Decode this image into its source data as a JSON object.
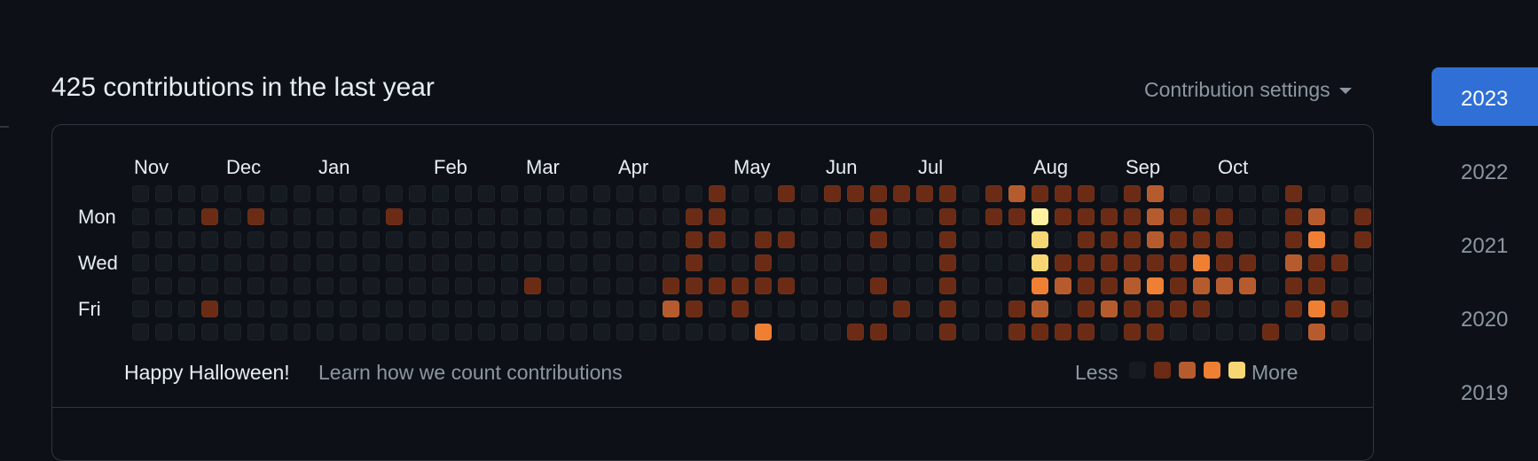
{
  "header": {
    "title": "425 contributions in the last year",
    "settings_label": "Contribution settings"
  },
  "calendar": {
    "months": [
      "Nov",
      "Dec",
      "Jan",
      "Feb",
      "Mar",
      "Apr",
      "May",
      "Jun",
      "Jul",
      "Aug",
      "Sep",
      "Oct"
    ],
    "day_labels": [
      "Mon",
      "Wed",
      "Fri"
    ],
    "weeks": [
      [
        0,
        0,
        0,
        0,
        0,
        0,
        0
      ],
      [
        0,
        0,
        0,
        0,
        0,
        0,
        0
      ],
      [
        0,
        0,
        0,
        0,
        0,
        0,
        0
      ],
      [
        0,
        1,
        0,
        0,
        0,
        1,
        0
      ],
      [
        0,
        0,
        0,
        0,
        0,
        0,
        0
      ],
      [
        0,
        1,
        0,
        0,
        0,
        0,
        0
      ],
      [
        0,
        0,
        0,
        0,
        0,
        0,
        0
      ],
      [
        0,
        0,
        0,
        0,
        0,
        0,
        0
      ],
      [
        0,
        0,
        0,
        0,
        0,
        0,
        0
      ],
      [
        0,
        0,
        0,
        0,
        0,
        0,
        0
      ],
      [
        0,
        0,
        0,
        0,
        0,
        0,
        0
      ],
      [
        0,
        1,
        0,
        0,
        0,
        0,
        0
      ],
      [
        0,
        0,
        0,
        0,
        0,
        0,
        0
      ],
      [
        0,
        0,
        0,
        0,
        0,
        0,
        0
      ],
      [
        0,
        0,
        0,
        0,
        0,
        0,
        0
      ],
      [
        0,
        0,
        0,
        0,
        0,
        0,
        0
      ],
      [
        0,
        0,
        0,
        0,
        0,
        0,
        0
      ],
      [
        0,
        0,
        0,
        0,
        1,
        0,
        0
      ],
      [
        0,
        0,
        0,
        0,
        0,
        0,
        0
      ],
      [
        0,
        0,
        0,
        0,
        0,
        0,
        0
      ],
      [
        0,
        0,
        0,
        0,
        0,
        0,
        0
      ],
      [
        0,
        0,
        0,
        0,
        0,
        0,
        0
      ],
      [
        0,
        0,
        0,
        0,
        0,
        0,
        0
      ],
      [
        0,
        0,
        0,
        0,
        1,
        2,
        0
      ],
      [
        0,
        1,
        1,
        1,
        1,
        1,
        0
      ],
      [
        1,
        1,
        1,
        0,
        1,
        0,
        0
      ],
      [
        0,
        0,
        0,
        0,
        1,
        1,
        0
      ],
      [
        0,
        0,
        1,
        1,
        1,
        0,
        3
      ],
      [
        1,
        0,
        1,
        0,
        1,
        0,
        0
      ],
      [
        0,
        0,
        0,
        0,
        0,
        0,
        0
      ],
      [
        1,
        0,
        0,
        0,
        0,
        0,
        0
      ],
      [
        1,
        0,
        0,
        0,
        0,
        0,
        1
      ],
      [
        1,
        1,
        1,
        0,
        1,
        0,
        1
      ],
      [
        1,
        0,
        0,
        0,
        0,
        1,
        0
      ],
      [
        1,
        0,
        0,
        0,
        0,
        0,
        0
      ],
      [
        1,
        1,
        1,
        1,
        1,
        1,
        1
      ],
      [
        0,
        0,
        0,
        0,
        0,
        0,
        0
      ],
      [
        1,
        1,
        0,
        0,
        0,
        0,
        0
      ],
      [
        2,
        1,
        0,
        0,
        0,
        1,
        1
      ],
      [
        1,
        5,
        4,
        4,
        3,
        2,
        1
      ],
      [
        1,
        1,
        0,
        1,
        2,
        0,
        1
      ],
      [
        1,
        1,
        1,
        1,
        1,
        1,
        1
      ],
      [
        0,
        1,
        1,
        1,
        1,
        2,
        0
      ],
      [
        1,
        1,
        1,
        1,
        2,
        1,
        1
      ],
      [
        2,
        2,
        2,
        1,
        3,
        1,
        1
      ],
      [
        0,
        1,
        1,
        1,
        1,
        1,
        0
      ],
      [
        0,
        1,
        1,
        3,
        2,
        1,
        0
      ],
      [
        0,
        1,
        1,
        1,
        2,
        0,
        0
      ],
      [
        0,
        0,
        0,
        1,
        2,
        0,
        0
      ],
      [
        0,
        0,
        0,
        0,
        0,
        0,
        1
      ],
      [
        1,
        1,
        1,
        2,
        1,
        1,
        0
      ],
      [
        0,
        2,
        3,
        1,
        1,
        3,
        2
      ],
      [
        0,
        0,
        0,
        1,
        0,
        1,
        0
      ],
      [
        0,
        1,
        1,
        0,
        0,
        0,
        0
      ]
    ],
    "level_colors": [
      "#161b22",
      "#6b2b14",
      "#b65b2e",
      "#ef7f33",
      "#f7d774",
      "#fff3a0"
    ]
  },
  "footer": {
    "happy": "Happy Halloween!",
    "learn_link": "Learn how we count contributions",
    "less": "Less",
    "more": "More",
    "legend_levels": [
      0,
      1,
      2,
      3,
      4
    ]
  },
  "years": [
    "2023",
    "2022",
    "2021",
    "2020",
    "2019"
  ]
}
